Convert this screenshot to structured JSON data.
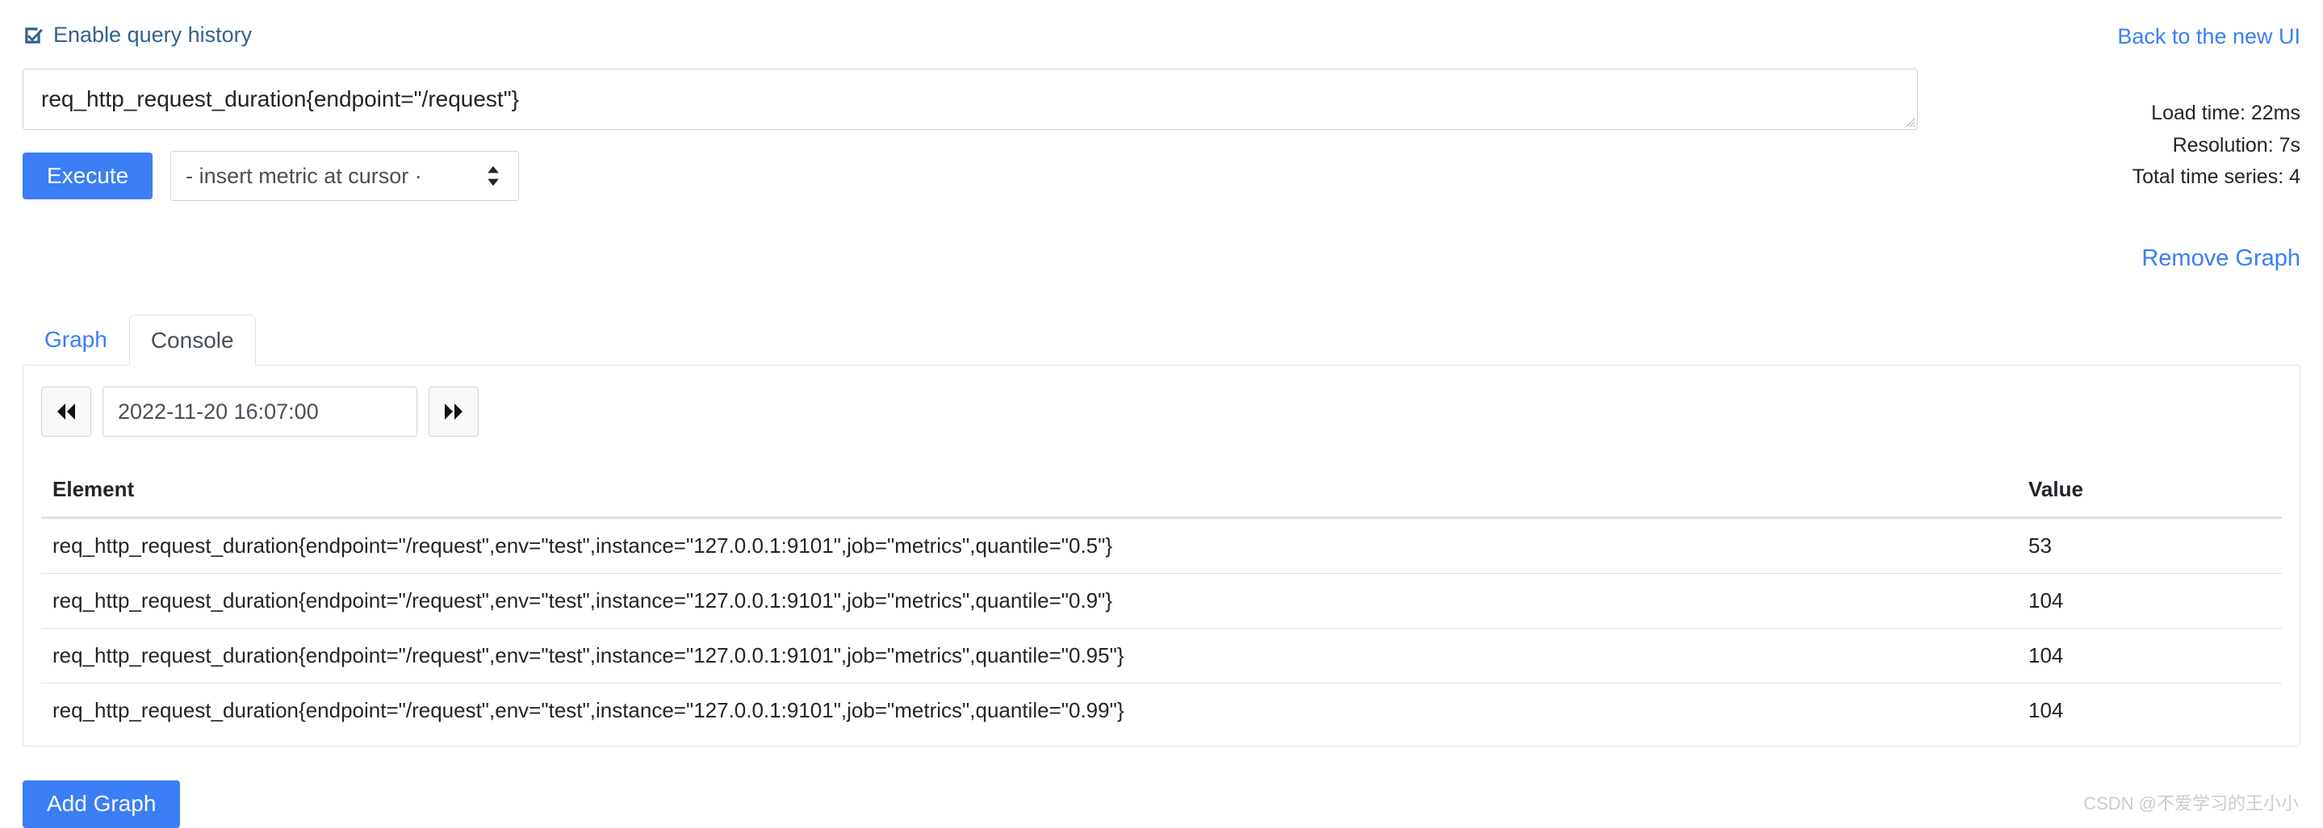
{
  "header": {
    "enable_query_history_label": "Enable query history",
    "query_history_checked": true,
    "checkbox_icon": "checked-checkbox-icon",
    "back_to_new_ui_label": "Back to the new UI"
  },
  "query": {
    "expression": "req_http_request_duration{endpoint=\"/request\"}",
    "placeholder": "Expression (press Shift+Enter for newlines)"
  },
  "toolbar": {
    "execute_label": "Execute",
    "metric_select_value": "- insert metric at cursor ·",
    "metric_select_icon": "stepper-updown-icon"
  },
  "stats": {
    "load_time": "Load time: 22ms",
    "resolution": "Resolution: 7s",
    "total_time_series": "Total time series: 4"
  },
  "actions": {
    "remove_graph_label": "Remove Graph",
    "add_graph_label": "Add Graph"
  },
  "tabs": [
    {
      "label": "Graph",
      "active": false,
      "name": "tab-graph"
    },
    {
      "label": "Console",
      "active": true,
      "name": "tab-console"
    }
  ],
  "time_nav": {
    "back_icon": "double-chevron-left-icon",
    "forward_icon": "double-chevron-right-icon",
    "timestamp": "2022-11-20 16:07:00",
    "placeholder": "Evaluation time"
  },
  "table": {
    "columns": [
      "Element",
      "Value"
    ],
    "rows": [
      {
        "element": "req_http_request_duration{endpoint=\"/request\",env=\"test\",instance=\"127.0.0.1:9101\",job=\"metrics\",quantile=\"0.5\"}",
        "value": "53"
      },
      {
        "element": "req_http_request_duration{endpoint=\"/request\",env=\"test\",instance=\"127.0.0.1:9101\",job=\"metrics\",quantile=\"0.9\"}",
        "value": "104"
      },
      {
        "element": "req_http_request_duration{endpoint=\"/request\",env=\"test\",instance=\"127.0.0.1:9101\",job=\"metrics\",quantile=\"0.95\"}",
        "value": "104"
      },
      {
        "element": "req_http_request_duration{endpoint=\"/request\",env=\"test\",instance=\"127.0.0.1:9101\",job=\"metrics\",quantile=\"0.99\"}",
        "value": "104"
      }
    ]
  },
  "footer": {
    "watermark": "CSDN @不爱学习的王小小"
  },
  "colors": {
    "primary_blue": "#3b7ef5",
    "link_blue": "#3b7ef5",
    "checkbox_blue": "#33618f",
    "border_gray": "#dee2e6",
    "input_border": "#ced4da"
  }
}
